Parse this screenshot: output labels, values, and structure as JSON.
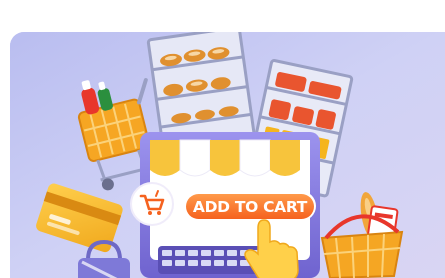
{
  "hero": {
    "cta_label": "ADD TO CART",
    "colors": {
      "background": "#c5c8f2",
      "awning_yellow": "#f7c43c",
      "cta_orange": "#ff7a2f",
      "laptop_purple": "#8a7fe0"
    },
    "icons": [
      "shopping-cart-icon",
      "hand-pointer-icon"
    ],
    "objects": [
      "shopping-cart",
      "credit-card",
      "shelf-bread",
      "shelf-goods",
      "laptop-shopfront",
      "shopping-bag",
      "basket-bread",
      "ketchup-bottle",
      "mustard-bottle"
    ]
  }
}
